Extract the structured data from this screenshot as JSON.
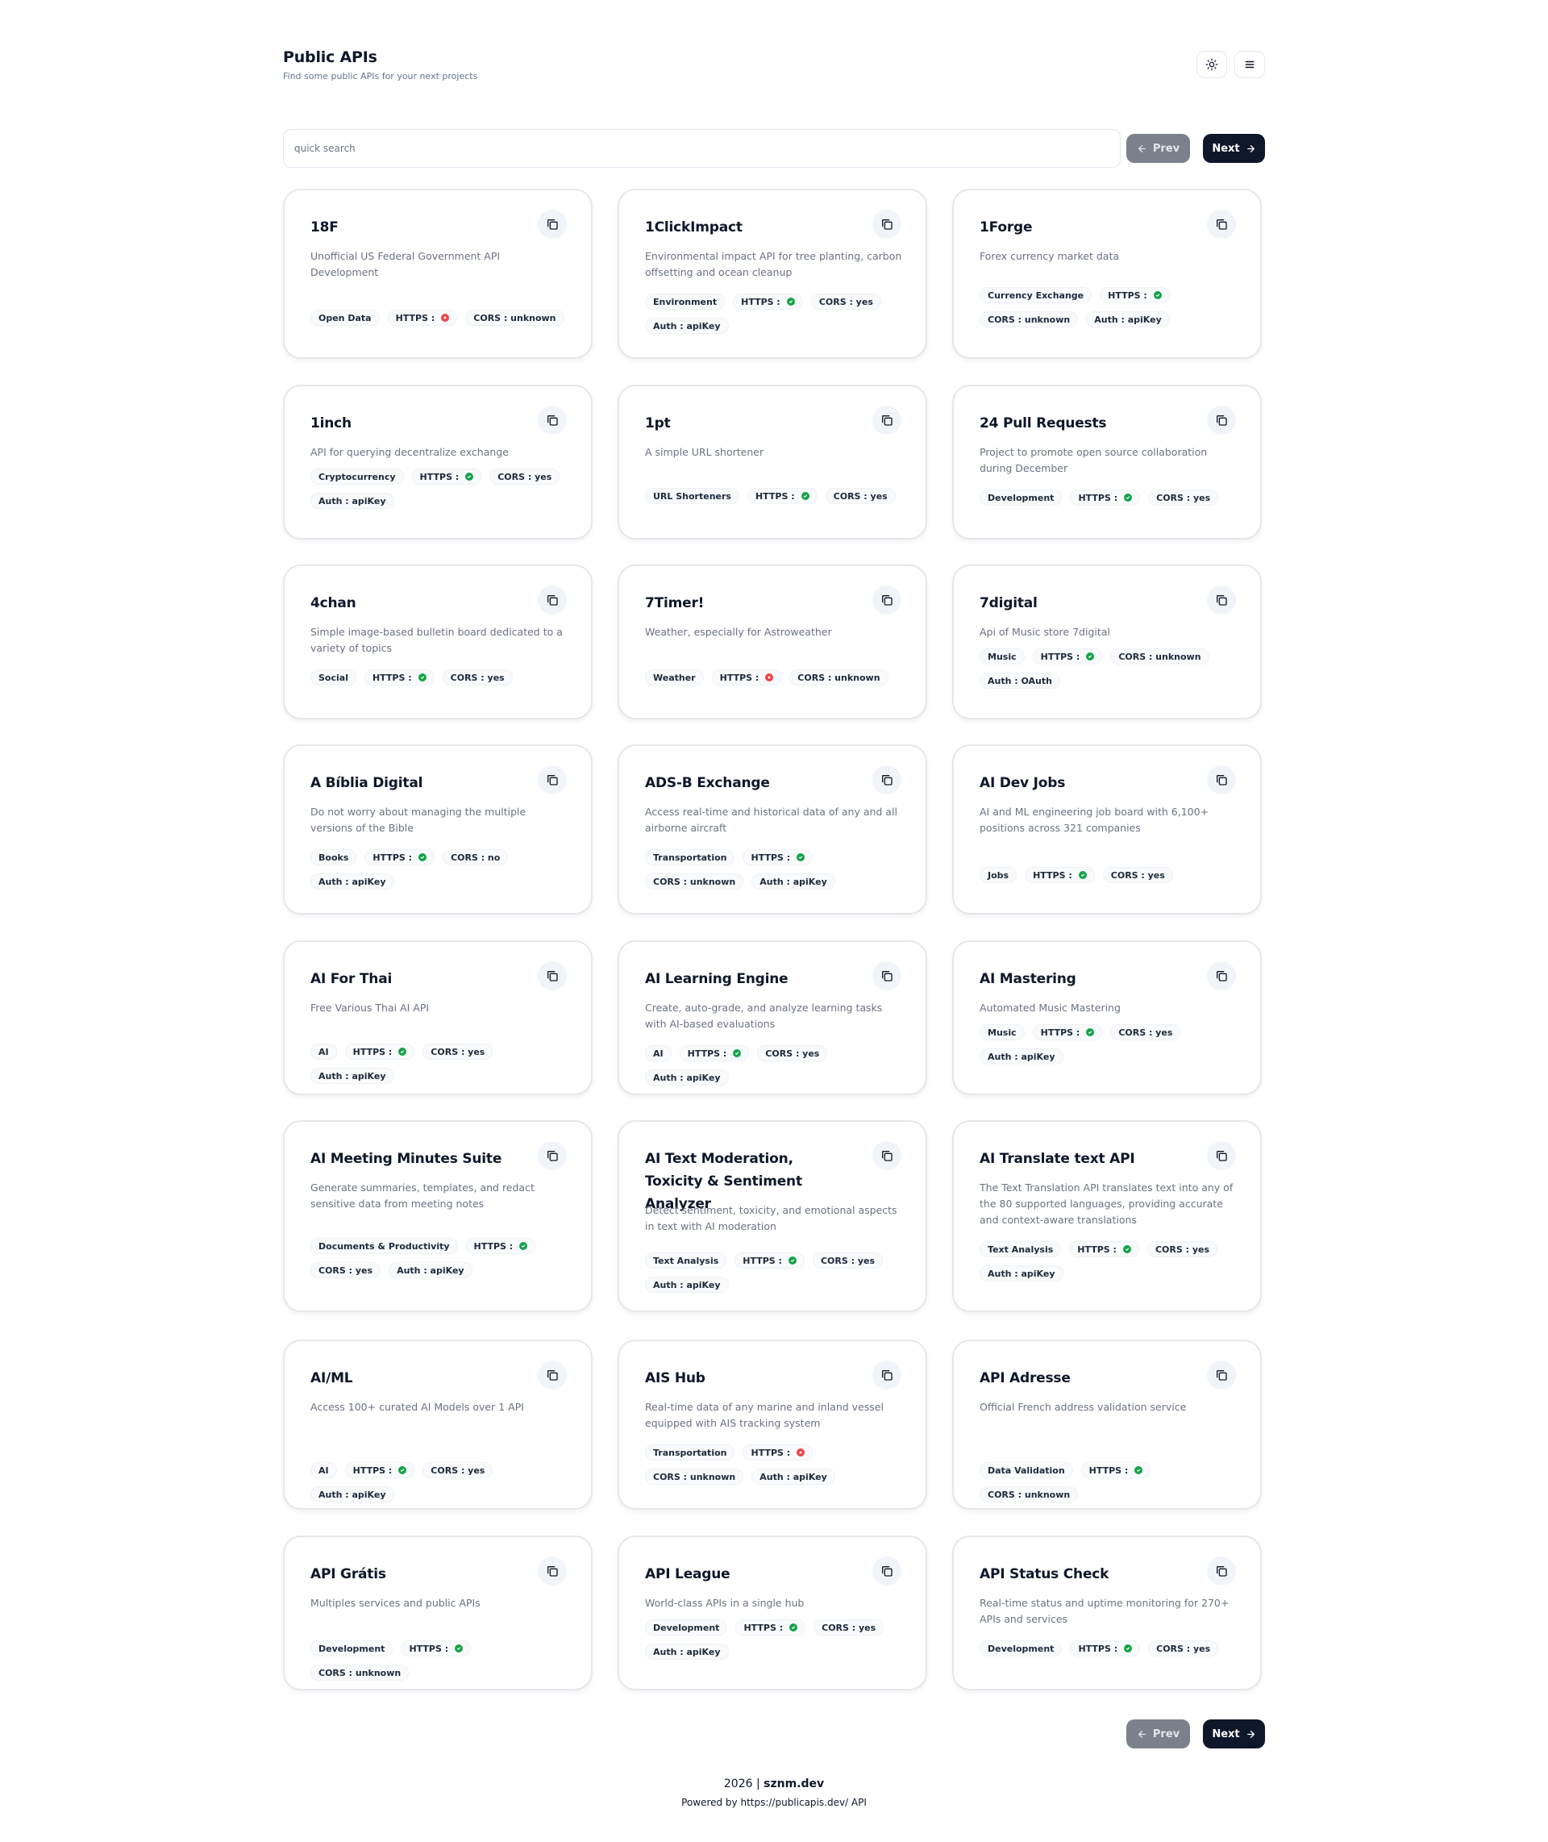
{
  "header": {
    "title": "Public APIs",
    "subtitle": "Find some public APIs for your next projects"
  },
  "search": {
    "placeholder": "quick search",
    "value": ""
  },
  "pagination": {
    "prev_label": "Prev",
    "next_label": "Next"
  },
  "labels": {
    "https": "HTTPS :"
  },
  "icons": {
    "theme": "sun-icon",
    "menu": "menu-icon",
    "copy": "copy-icon",
    "prev": "arrow-left-icon",
    "next": "arrow-right-icon",
    "https_ok": "check-circle-icon",
    "https_no": "x-circle-icon"
  },
  "colors": {
    "https_ok": "#16a34a",
    "https_no": "#ef4444",
    "primary": "#0f172a",
    "disabled": "#7b818b"
  },
  "apis": [
    {
      "name": "18F",
      "desc": "Unofficial US Federal Government API Development",
      "category": "Open Data",
      "https": false,
      "cors": "CORS : unknown",
      "auth": ""
    },
    {
      "name": "1ClickImpact",
      "desc": "Environmental impact API for tree planting, carbon offsetting and ocean cleanup",
      "category": "Environment",
      "https": true,
      "cors": "CORS : yes",
      "auth": "Auth : apiKey"
    },
    {
      "name": "1Forge",
      "desc": "Forex currency market data",
      "category": "Currency Exchange",
      "https": true,
      "cors": "CORS : unknown",
      "auth": "Auth : apiKey"
    },
    {
      "name": "1inch",
      "desc": "API for querying decentralize exchange",
      "category": "Cryptocurrency",
      "https": true,
      "cors": "CORS : yes",
      "auth": "Auth : apiKey"
    },
    {
      "name": "1pt",
      "desc": "A simple URL shortener",
      "category": "URL Shorteners",
      "https": true,
      "cors": "CORS : yes",
      "auth": ""
    },
    {
      "name": "24 Pull Requests",
      "desc": "Project to promote open source collaboration during December",
      "category": "Development",
      "https": true,
      "cors": "CORS : yes",
      "auth": ""
    },
    {
      "name": "4chan",
      "desc": "Simple image-based bulletin board dedicated to a variety of topics",
      "category": "Social",
      "https": true,
      "cors": "CORS : yes",
      "auth": ""
    },
    {
      "name": "7Timer!",
      "desc": "Weather, especially for Astroweather",
      "category": "Weather",
      "https": false,
      "cors": "CORS : unknown",
      "auth": ""
    },
    {
      "name": "7digital",
      "desc": "Api of Music store 7digital",
      "category": "Music",
      "https": true,
      "cors": "CORS : unknown",
      "auth": "Auth : OAuth"
    },
    {
      "name": "A Bíblia Digital",
      "desc": "Do not worry about managing the multiple versions of the Bible",
      "category": "Books",
      "https": true,
      "cors": "CORS : no",
      "auth": "Auth : apiKey"
    },
    {
      "name": "ADS-B Exchange",
      "desc": "Access real-time and historical data of any and all airborne aircraft",
      "category": "Transportation",
      "https": true,
      "cors": "CORS : unknown",
      "auth": "Auth : apiKey"
    },
    {
      "name": "AI Dev Jobs",
      "desc": "AI and ML engineering job board with 6,100+ positions across 321 companies",
      "category": "Jobs",
      "https": true,
      "cors": "CORS : yes",
      "auth": ""
    },
    {
      "name": "AI For Thai",
      "desc": "Free Various Thai AI API",
      "category": "AI",
      "https": true,
      "cors": "CORS : yes",
      "auth": "Auth : apiKey"
    },
    {
      "name": "AI Learning Engine",
      "desc": "Create, auto-grade, and analyze learning tasks with AI-based evaluations",
      "category": "AI",
      "https": true,
      "cors": "CORS : yes",
      "auth": "Auth : apiKey"
    },
    {
      "name": "AI Mastering",
      "desc": "Automated Music Mastering",
      "category": "Music",
      "https": true,
      "cors": "CORS : yes",
      "auth": "Auth : apiKey"
    },
    {
      "name": "AI Meeting Minutes Suite",
      "desc": "Generate summaries, templates, and redact sensitive data from meeting notes",
      "category": "Documents & Productivity",
      "https": true,
      "cors": "CORS : yes",
      "auth": "Auth : apiKey"
    },
    {
      "name": "AI Text Moderation, Toxicity & Sentiment Analyzer",
      "desc": "Detect sentiment, toxicity, and emotional aspects in text with AI moderation",
      "category": "Text Analysis",
      "https": true,
      "cors": "CORS : yes",
      "auth": "Auth : apiKey"
    },
    {
      "name": "AI Translate text API",
      "desc": "The Text Translation API translates text into any of the 80 supported languages, providing accurate and context-aware translations",
      "category": "Text Analysis",
      "https": true,
      "cors": "CORS : yes",
      "auth": "Auth : apiKey"
    },
    {
      "name": "AI/ML",
      "desc": "Access 100+ curated AI Models over 1 API",
      "category": "AI",
      "https": true,
      "cors": "CORS : yes",
      "auth": "Auth : apiKey"
    },
    {
      "name": "AIS Hub",
      "desc": "Real-time data of any marine and inland vessel equipped with AIS tracking system",
      "category": "Transportation",
      "https": false,
      "cors": "CORS : unknown",
      "auth": "Auth : apiKey"
    },
    {
      "name": "API Adresse",
      "desc": "Official French address validation service",
      "category": "Data Validation",
      "https": true,
      "cors": "CORS : unknown",
      "auth": ""
    },
    {
      "name": "API Grátis",
      "desc": "Multiples services and public APIs",
      "category": "Development",
      "https": true,
      "cors": "CORS : unknown",
      "auth": ""
    },
    {
      "name": "API League",
      "desc": "World-class APIs in a single hub",
      "category": "Development",
      "https": true,
      "cors": "CORS : yes",
      "auth": "Auth : apiKey"
    },
    {
      "name": "API Status Check",
      "desc": "Real-time status and uptime monitoring for 270+ APIs and services",
      "category": "Development",
      "https": true,
      "cors": "CORS : yes",
      "auth": ""
    }
  ],
  "footer": {
    "year": "2026 |",
    "site": "sznm.dev",
    "powered": "Powered by https://publicapis.dev/ API"
  }
}
